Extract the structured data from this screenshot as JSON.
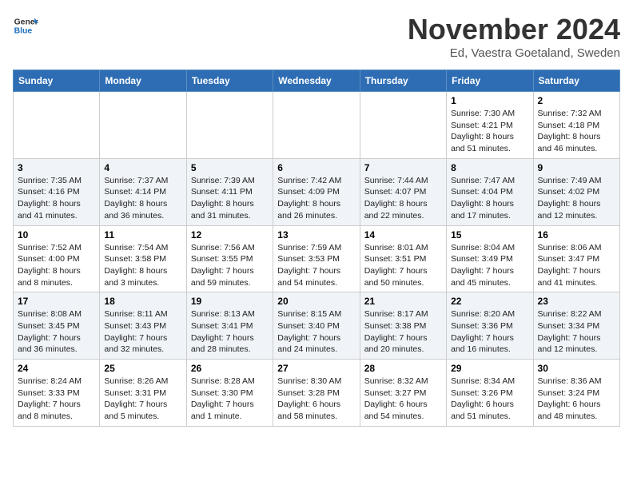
{
  "header": {
    "logo_general": "General",
    "logo_blue": "Blue",
    "month_title": "November 2024",
    "location": "Ed, Vaestra Goetaland, Sweden"
  },
  "weekdays": [
    "Sunday",
    "Monday",
    "Tuesday",
    "Wednesday",
    "Thursday",
    "Friday",
    "Saturday"
  ],
  "weeks": [
    [
      {
        "day": "",
        "info": ""
      },
      {
        "day": "",
        "info": ""
      },
      {
        "day": "",
        "info": ""
      },
      {
        "day": "",
        "info": ""
      },
      {
        "day": "",
        "info": ""
      },
      {
        "day": "1",
        "info": "Sunrise: 7:30 AM\nSunset: 4:21 PM\nDaylight: 8 hours and 51 minutes."
      },
      {
        "day": "2",
        "info": "Sunrise: 7:32 AM\nSunset: 4:18 PM\nDaylight: 8 hours and 46 minutes."
      }
    ],
    [
      {
        "day": "3",
        "info": "Sunrise: 7:35 AM\nSunset: 4:16 PM\nDaylight: 8 hours and 41 minutes."
      },
      {
        "day": "4",
        "info": "Sunrise: 7:37 AM\nSunset: 4:14 PM\nDaylight: 8 hours and 36 minutes."
      },
      {
        "day": "5",
        "info": "Sunrise: 7:39 AM\nSunset: 4:11 PM\nDaylight: 8 hours and 31 minutes."
      },
      {
        "day": "6",
        "info": "Sunrise: 7:42 AM\nSunset: 4:09 PM\nDaylight: 8 hours and 26 minutes."
      },
      {
        "day": "7",
        "info": "Sunrise: 7:44 AM\nSunset: 4:07 PM\nDaylight: 8 hours and 22 minutes."
      },
      {
        "day": "8",
        "info": "Sunrise: 7:47 AM\nSunset: 4:04 PM\nDaylight: 8 hours and 17 minutes."
      },
      {
        "day": "9",
        "info": "Sunrise: 7:49 AM\nSunset: 4:02 PM\nDaylight: 8 hours and 12 minutes."
      }
    ],
    [
      {
        "day": "10",
        "info": "Sunrise: 7:52 AM\nSunset: 4:00 PM\nDaylight: 8 hours and 8 minutes."
      },
      {
        "day": "11",
        "info": "Sunrise: 7:54 AM\nSunset: 3:58 PM\nDaylight: 8 hours and 3 minutes."
      },
      {
        "day": "12",
        "info": "Sunrise: 7:56 AM\nSunset: 3:55 PM\nDaylight: 7 hours and 59 minutes."
      },
      {
        "day": "13",
        "info": "Sunrise: 7:59 AM\nSunset: 3:53 PM\nDaylight: 7 hours and 54 minutes."
      },
      {
        "day": "14",
        "info": "Sunrise: 8:01 AM\nSunset: 3:51 PM\nDaylight: 7 hours and 50 minutes."
      },
      {
        "day": "15",
        "info": "Sunrise: 8:04 AM\nSunset: 3:49 PM\nDaylight: 7 hours and 45 minutes."
      },
      {
        "day": "16",
        "info": "Sunrise: 8:06 AM\nSunset: 3:47 PM\nDaylight: 7 hours and 41 minutes."
      }
    ],
    [
      {
        "day": "17",
        "info": "Sunrise: 8:08 AM\nSunset: 3:45 PM\nDaylight: 7 hours and 36 minutes."
      },
      {
        "day": "18",
        "info": "Sunrise: 8:11 AM\nSunset: 3:43 PM\nDaylight: 7 hours and 32 minutes."
      },
      {
        "day": "19",
        "info": "Sunrise: 8:13 AM\nSunset: 3:41 PM\nDaylight: 7 hours and 28 minutes."
      },
      {
        "day": "20",
        "info": "Sunrise: 8:15 AM\nSunset: 3:40 PM\nDaylight: 7 hours and 24 minutes."
      },
      {
        "day": "21",
        "info": "Sunrise: 8:17 AM\nSunset: 3:38 PM\nDaylight: 7 hours and 20 minutes."
      },
      {
        "day": "22",
        "info": "Sunrise: 8:20 AM\nSunset: 3:36 PM\nDaylight: 7 hours and 16 minutes."
      },
      {
        "day": "23",
        "info": "Sunrise: 8:22 AM\nSunset: 3:34 PM\nDaylight: 7 hours and 12 minutes."
      }
    ],
    [
      {
        "day": "24",
        "info": "Sunrise: 8:24 AM\nSunset: 3:33 PM\nDaylight: 7 hours and 8 minutes."
      },
      {
        "day": "25",
        "info": "Sunrise: 8:26 AM\nSunset: 3:31 PM\nDaylight: 7 hours and 5 minutes."
      },
      {
        "day": "26",
        "info": "Sunrise: 8:28 AM\nSunset: 3:30 PM\nDaylight: 7 hours and 1 minute."
      },
      {
        "day": "27",
        "info": "Sunrise: 8:30 AM\nSunset: 3:28 PM\nDaylight: 6 hours and 58 minutes."
      },
      {
        "day": "28",
        "info": "Sunrise: 8:32 AM\nSunset: 3:27 PM\nDaylight: 6 hours and 54 minutes."
      },
      {
        "day": "29",
        "info": "Sunrise: 8:34 AM\nSunset: 3:26 PM\nDaylight: 6 hours and 51 minutes."
      },
      {
        "day": "30",
        "info": "Sunrise: 8:36 AM\nSunset: 3:24 PM\nDaylight: 6 hours and 48 minutes."
      }
    ]
  ]
}
